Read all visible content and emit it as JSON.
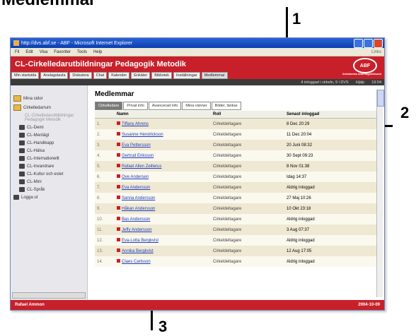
{
  "heading": "Medlemmar",
  "callouts": [
    "1",
    "2",
    "3"
  ],
  "window": {
    "title": "http://dvs.abf.se - ABF - Microsoft Internet Explorer",
    "menu": [
      "Fil",
      "Edit",
      "Visa",
      "Favoriter",
      "Tools",
      "Help"
    ],
    "menu_right": "Links"
  },
  "banner": {
    "title": "CL-Cirkelledarutbildningar Pedagogik Metodik",
    "logo": "ABF",
    "logo_sub": "Arbetarnas bildningsförbund"
  },
  "nav": {
    "items": [
      "Min startsida",
      "Anslagstavla",
      "Diskutera",
      "Chat",
      "Kalender",
      "Enkäter",
      "Bibliotek",
      "Inställningar",
      "Medlemmar"
    ],
    "active_index": 8
  },
  "status": {
    "online": "4 inloggad i cirkeln, 9 i DVS",
    "help": "Hjälp",
    "time": "19:04"
  },
  "sidebar": {
    "items": [
      {
        "label": "Mina sidor",
        "kind": "folder",
        "level": 0
      },
      {
        "label": "Cirkelledarrum",
        "kind": "folder",
        "level": 0
      },
      {
        "label": "CL-Cirkelledarutbildningar Pedagogik Metodik",
        "kind": "page",
        "level": 2
      },
      {
        "label": "CL-Demi",
        "kind": "group",
        "level": 1
      },
      {
        "label": "CL-Mentägt",
        "kind": "group",
        "level": 1
      },
      {
        "label": "CL-Handikapp",
        "kind": "group",
        "level": 1
      },
      {
        "label": "CL-Hälsa",
        "kind": "group",
        "level": 1
      },
      {
        "label": "CL-Internationellt",
        "kind": "group",
        "level": 1
      },
      {
        "label": "CL-Invandrare",
        "kind": "group",
        "level": 1
      },
      {
        "label": "CL-Kultur och estet",
        "kind": "group",
        "level": 1
      },
      {
        "label": "CL-Mini",
        "kind": "group",
        "level": 1
      },
      {
        "label": "CL-Språk",
        "kind": "group",
        "level": 1
      },
      {
        "label": "Logga ut",
        "kind": "logout",
        "level": 0
      }
    ]
  },
  "content": {
    "title": "Medlemmar",
    "tabs": [
      "Cirkelledare",
      "Privat info",
      "Avancerad info",
      "Mina vänner",
      "Bilder, länkar"
    ],
    "active_tab": 0,
    "columns": [
      "Namn",
      "Roll",
      "Senast inloggad"
    ],
    "rows": [
      {
        "n": "1.",
        "name": "Tiffany Ahrens",
        "role": "Cirkeldeltagare",
        "last": "8 Dec 20:29"
      },
      {
        "n": "2.",
        "name": "Susanne Hendrickson",
        "role": "Cirkeldeltagare",
        "last": "11 Dec 20:04"
      },
      {
        "n": "3.",
        "name": "Eva Pettersson",
        "role": "Cirkeldeltagare",
        "last": "20 Juni 08:32"
      },
      {
        "n": "4.",
        "name": "Gertrud Eriksson",
        "role": "Cirkeldeltagare",
        "last": "30 Sept 09:23"
      },
      {
        "n": "5.",
        "name": "Rafael Allen Zeillerus",
        "role": "Cirkeldeltagare",
        "last": "8 Nov 01:38"
      },
      {
        "n": "6.",
        "name": "Ove Andersen",
        "role": "Cirkeldeltagare",
        "last": "Idag 14:37"
      },
      {
        "n": "7.",
        "name": "Eva Andersson",
        "role": "Cirkeldeltagare",
        "last": "Aldrig inloggad"
      },
      {
        "n": "8.",
        "name": "Sanna Andersson",
        "role": "Cirkeldeltagare",
        "last": "27 Maj 10:26"
      },
      {
        "n": "9.",
        "name": "Håkan Andersson",
        "role": "Cirkeldeltagare",
        "last": "10 Okt 23:18"
      },
      {
        "n": "10.",
        "name": "Bas Andersson",
        "role": "Cirkeldeltagare",
        "last": "Aldrig inloggad"
      },
      {
        "n": "11.",
        "name": "Jeffy Andersson",
        "role": "Cirkeldeltagare",
        "last": "3 Aug 07:37"
      },
      {
        "n": "12.",
        "name": "Eva-Lotta Bergkvist",
        "role": "Cirkeldeltagare",
        "last": "Aldrig inloggad"
      },
      {
        "n": "13.",
        "name": "Annika Bergkvist",
        "role": "Cirkeldeltagare",
        "last": "12 Aug 17:05"
      },
      {
        "n": "14.",
        "name": "Claes Carlsson",
        "role": "Cirkeldeltagare",
        "last": "Aldrig inloggad"
      }
    ]
  },
  "footer": {
    "left": "Rafael Ammon",
    "right": "2004-10-09"
  }
}
